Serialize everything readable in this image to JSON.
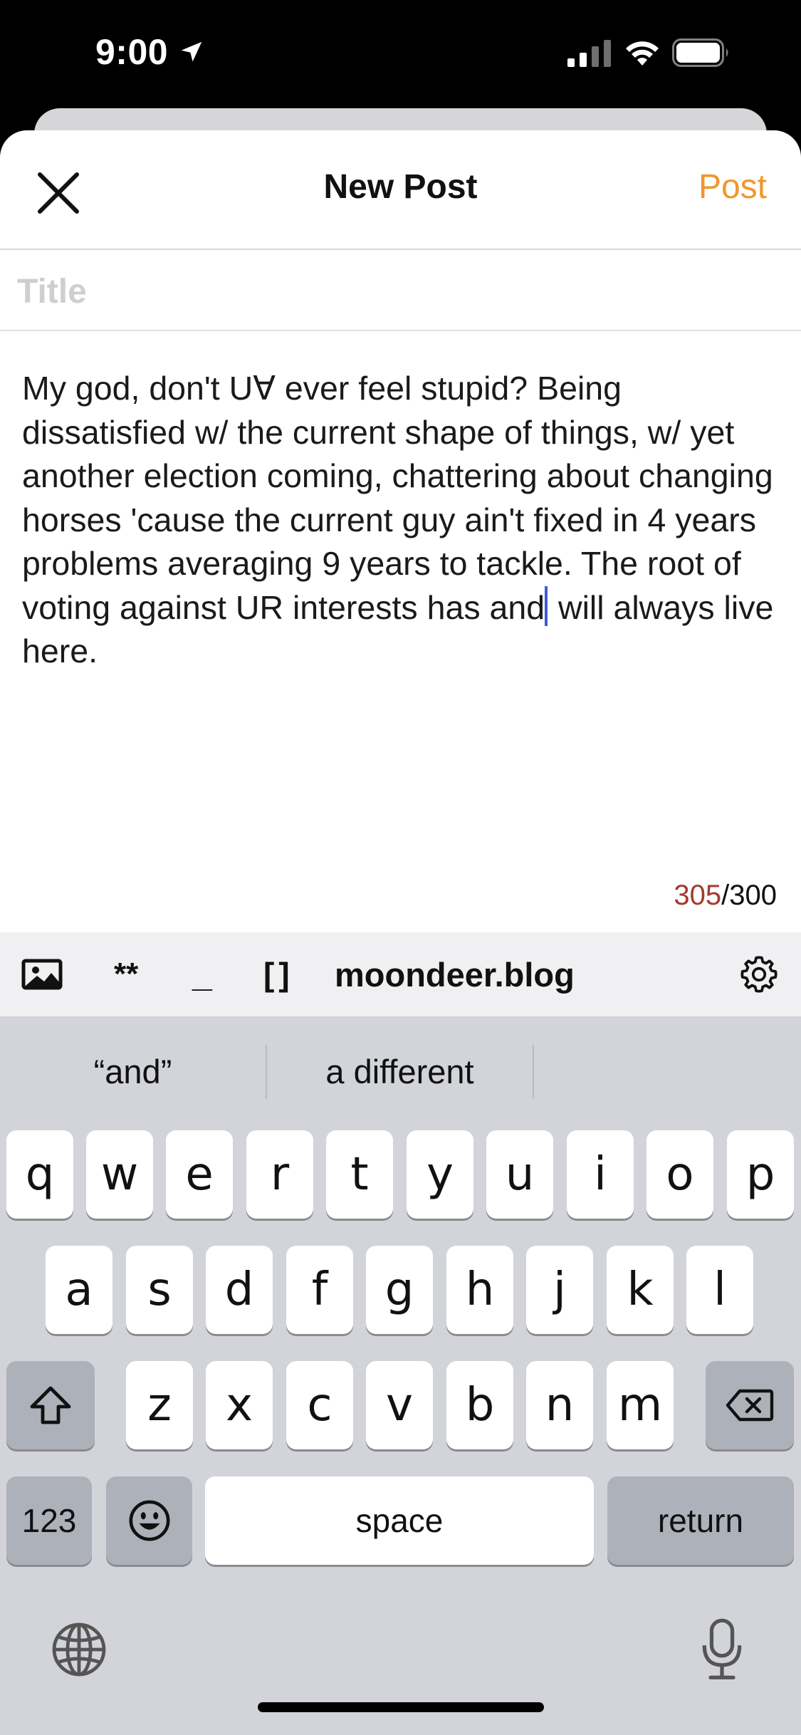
{
  "status_bar": {
    "time": "9:00"
  },
  "header": {
    "title": "New Post",
    "post_label": "Post"
  },
  "title_field": {
    "placeholder": "Title",
    "value": ""
  },
  "body": {
    "text_before_cursor": "My god, don't U∀ ever feel stupid? Being dissatisfied w/ the current shape of things, w/ yet another election coming, chattering about changing horses 'cause the current guy ain't fixed in 4 years problems averaging 9 years to tackle. The root of voting against UR interests has and",
    "text_after_cursor": " will always live here."
  },
  "counter": {
    "count": "305",
    "separator": "/",
    "limit": "300"
  },
  "format_toolbar": {
    "bold_label": "**",
    "italic_label": "_",
    "link_label": "[]",
    "blog_label": "moondeer.blog"
  },
  "keyboard": {
    "suggestions": [
      "“and”",
      "a different"
    ],
    "row1": [
      "q",
      "w",
      "e",
      "r",
      "t",
      "y",
      "u",
      "i",
      "o",
      "p"
    ],
    "row2": [
      "a",
      "s",
      "d",
      "f",
      "g",
      "h",
      "j",
      "k",
      "l"
    ],
    "row3": [
      "z",
      "x",
      "c",
      "v",
      "b",
      "n",
      "m"
    ],
    "numbers_label": "123",
    "space_label": "space",
    "return_label": "return"
  },
  "colors": {
    "accent": "#f0962f",
    "counter_over": "#a23b2f",
    "cursor": "#3b5bdb"
  }
}
